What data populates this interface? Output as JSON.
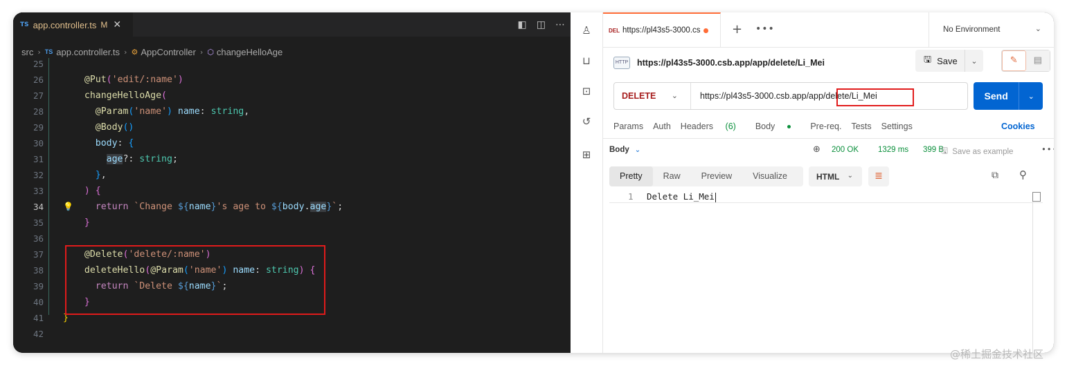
{
  "editor": {
    "tab": {
      "badge": "TS",
      "filename": "app.controller.ts",
      "modified": "M",
      "close": "✕"
    },
    "breadcrumb": {
      "root": "src",
      "file_badge": "TS",
      "file": "app.controller.ts",
      "class": "AppController",
      "method": "changeHelloAge"
    },
    "lines": [
      {
        "num": "25"
      },
      {
        "num": "26"
      },
      {
        "num": "27"
      },
      {
        "num": "28"
      },
      {
        "num": "29"
      },
      {
        "num": "30"
      },
      {
        "num": "31"
      },
      {
        "num": "32"
      },
      {
        "num": "33"
      },
      {
        "num": "34"
      },
      {
        "num": "35"
      },
      {
        "num": "36"
      },
      {
        "num": "37"
      },
      {
        "num": "38"
      },
      {
        "num": "39"
      },
      {
        "num": "40"
      },
      {
        "num": "41"
      },
      {
        "num": "42"
      }
    ],
    "code": {
      "l26": {
        "at": "@",
        "dec": "Put",
        "p1": "(",
        "str": "'edit/:name'",
        "p2": ")"
      },
      "l27": {
        "fn": "changeHelloAge",
        "p": "("
      },
      "l28": {
        "at": "@",
        "dec": "Param",
        "p1": "(",
        "str": "'name'",
        "p2": ")",
        "var": " name",
        "colon": ": ",
        "type": "string",
        "comma": ","
      },
      "l29": {
        "at": "@",
        "dec": "Body",
        "p": "()"
      },
      "l30": {
        "var": "body",
        "colon": ": ",
        "br": "{"
      },
      "l31": {
        "var": "age",
        "opt": "?: ",
        "type": "string",
        "semi": ";"
      },
      "l32": {
        "br": "}",
        "comma": ","
      },
      "l33": {
        "p": ")",
        "sp": " ",
        "br": "{"
      },
      "l34": {
        "kw": "return",
        "sp": " ",
        "t1": "`Change ",
        "i1": "${",
        "v1": "name",
        "i2": "}",
        "t2": "'s age to ",
        "i3": "${",
        "v2": "body",
        "dot": ".",
        "v3": "age",
        "i4": "}",
        "t3": "`",
        "semi": ";"
      },
      "l35": {
        "br": "}"
      },
      "l37": {
        "at": "@",
        "dec": "Delete",
        "p1": "(",
        "str": "'delete/:name'",
        "p2": ")"
      },
      "l38": {
        "fn": "deleteHello",
        "p1": "(",
        "at": "@",
        "dec": "Param",
        "p2": "(",
        "str": "'name'",
        "p3": ")",
        "var": " name",
        "colon": ": ",
        "type": "string",
        "p4": ")",
        "sp": " ",
        "br": "{"
      },
      "l39": {
        "kw": "return",
        "sp": " ",
        "t1": "`Delete ",
        "i1": "${",
        "v1": "name",
        "i2": "}",
        "t2": "`",
        "semi": ";"
      },
      "l40": {
        "br": "}"
      },
      "l41": {
        "br": "}"
      }
    }
  },
  "postman": {
    "tab": {
      "method_badge": "DEL",
      "url": "https://pl43s5-3000.cs"
    },
    "new_tab": "+",
    "more": "•••",
    "environment": "No Environment",
    "request_name": "https://pl43s5-3000.csb.app/app/delete/Li_Mei",
    "http_icon": "HTTP",
    "save_label": "Save",
    "method": "DELETE",
    "url": "https://pl43s5-3000.csb.app/app/delete/Li_Mei",
    "send_label": "Send",
    "request_tabs": [
      {
        "label": "Params"
      },
      {
        "label": "Auth"
      },
      {
        "label": "Headers",
        "count": "(6)"
      },
      {
        "label": "Body"
      },
      {
        "label": "Pre-req."
      },
      {
        "label": "Tests"
      },
      {
        "label": "Settings"
      }
    ],
    "cookies_label": "Cookies",
    "response": {
      "body_label": "Body",
      "status": "200 OK",
      "time": "1329 ms",
      "size": "399 B",
      "save_example": "Save as example",
      "format_tabs": [
        "Pretty",
        "Raw",
        "Preview",
        "Visualize"
      ],
      "format": "HTML",
      "line_number": "1",
      "content": "Delete Li_Mei"
    }
  },
  "watermark": "@稀土掘金技术社区",
  "colors": {
    "accent": "#ff6c37",
    "send": "#0265d2",
    "delete": "#a61c1c",
    "ok": "#0a8f3b",
    "highlight_box": "#e11b1b"
  }
}
